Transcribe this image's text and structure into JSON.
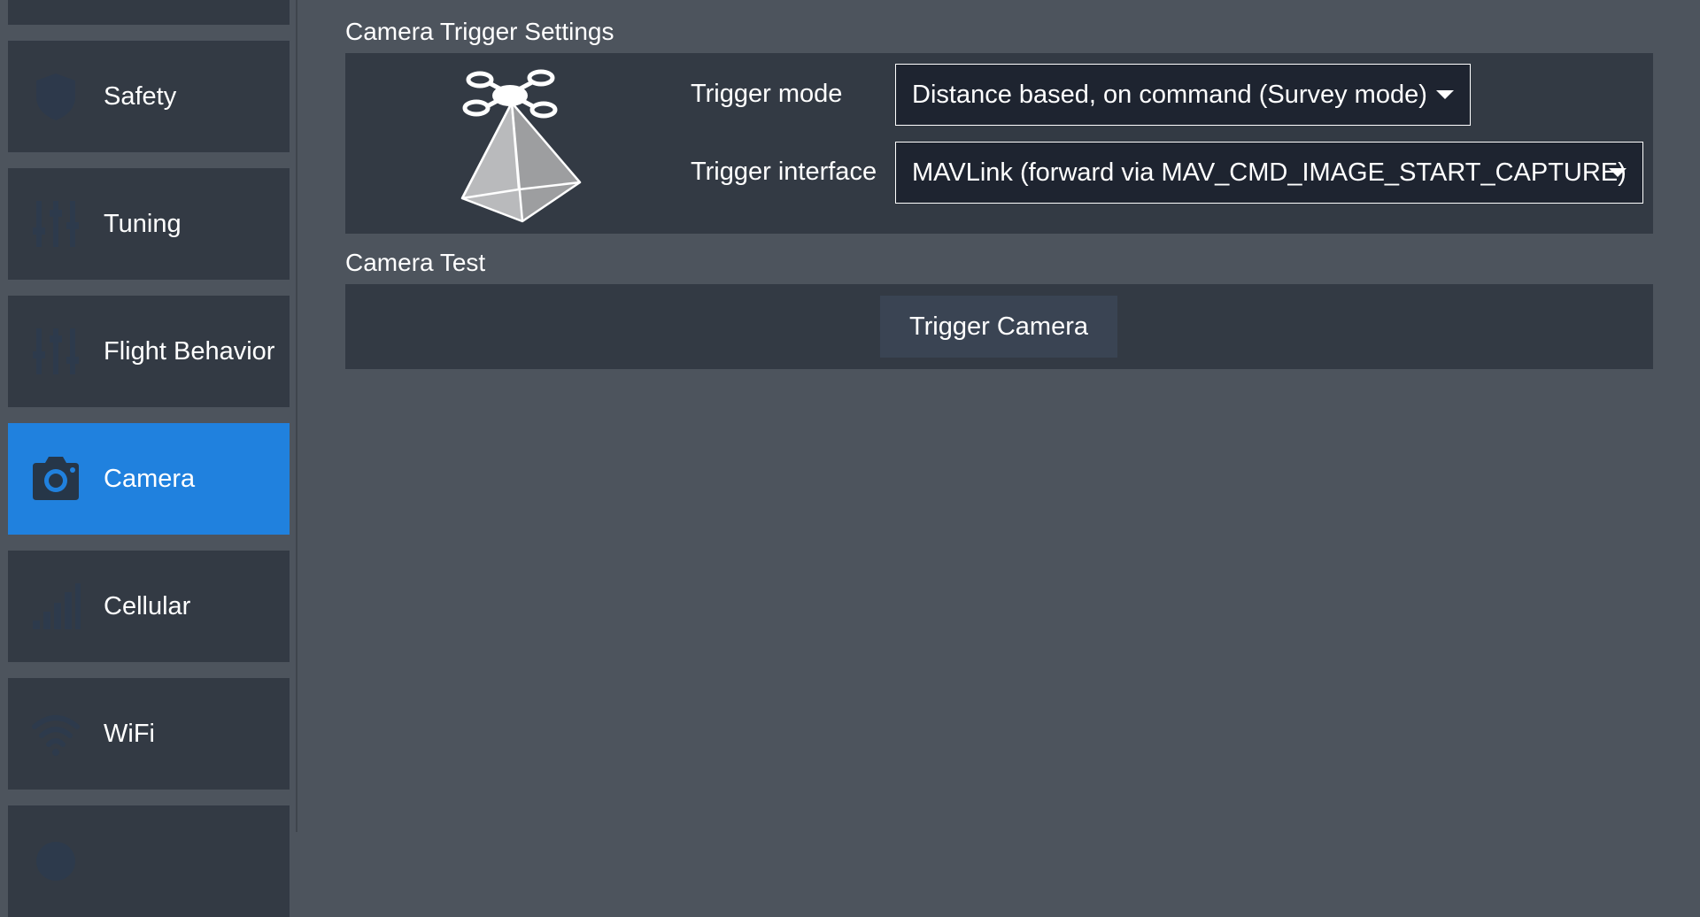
{
  "sidebar": {
    "items": [
      {
        "label": "",
        "icon": "settings-icon"
      },
      {
        "label": "Safety",
        "icon": "safety-icon"
      },
      {
        "label": "Tuning",
        "icon": "tuning-icon"
      },
      {
        "label": "Flight Behavior",
        "icon": "flight-behavior-icon"
      },
      {
        "label": "Camera",
        "icon": "camera-icon",
        "active": true
      },
      {
        "label": "Cellular",
        "icon": "cellular-icon"
      },
      {
        "label": "WiFi",
        "icon": "wifi-icon"
      },
      {
        "label": "",
        "icon": "more-icon"
      }
    ]
  },
  "trigger_settings": {
    "title": "Camera Trigger Settings",
    "illustration": "drone-camera-pyramid-icon",
    "mode_label": "Trigger mode",
    "mode_value": "Distance based, on command (Survey mode)",
    "interface_label": "Trigger interface",
    "interface_value": "MAVLink (forward via MAV_CMD_IMAGE_START_CAPTURE)"
  },
  "camera_test": {
    "title": "Camera Test",
    "trigger_button": "Trigger Camera"
  },
  "colors": {
    "background": "#4d545d",
    "panel": "#333a44",
    "active_nav": "#2081de",
    "combo_bg": "#1e2430"
  }
}
